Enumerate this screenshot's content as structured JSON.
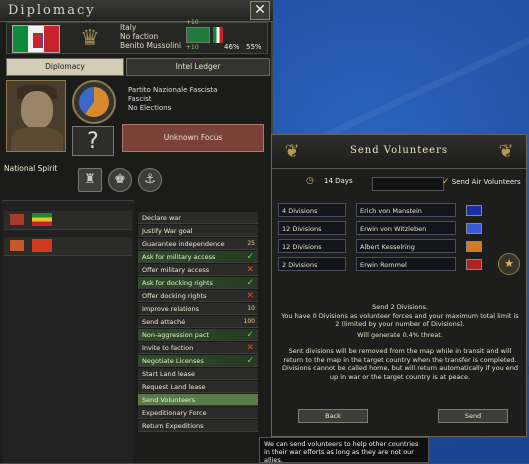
{
  "diplomacy": {
    "title": "Diplomacy",
    "close_label": "✕",
    "country": {
      "name": "Italy",
      "faction": "No faction",
      "leader": "Benito Mussolini",
      "stat_a": "46%",
      "stat_b": "55%",
      "small_a": "+10",
      "small_b": "+10"
    },
    "tabs": [
      {
        "label": "Diplomacy"
      },
      {
        "label": "Intel Ledger"
      }
    ],
    "party": {
      "name": "Partito Nazionale Fascista",
      "ideology": "Fascist",
      "elections": "No Elections"
    },
    "focus_label": "Unknown Focus",
    "question_mark": "?",
    "national_spirit_label": "National Spirit",
    "actions": [
      {
        "label": "Declare war",
        "mark": ""
      },
      {
        "label": "Justify War goal",
        "mark": ""
      },
      {
        "label": "Guarantee independence",
        "mark": "25"
      },
      {
        "label": "Ask for military access",
        "mark": "✓"
      },
      {
        "label": "Offer military access",
        "mark": "✕"
      },
      {
        "label": "Ask for docking rights",
        "mark": "✓"
      },
      {
        "label": "Offer docking rights",
        "mark": "✕"
      },
      {
        "label": "Improve relations",
        "mark": "10"
      },
      {
        "label": "Send attaché",
        "mark": "100"
      },
      {
        "label": "Non-aggression pact",
        "mark": "✓"
      },
      {
        "label": "Invite to faction",
        "mark": "✕"
      },
      {
        "label": "Negotiate Licenses",
        "mark": "✓"
      },
      {
        "label": "Start Land lease",
        "mark": ""
      },
      {
        "label": "Request Land lease",
        "mark": ""
      },
      {
        "label": "Send Volunteers",
        "mark": ""
      },
      {
        "label": "Expeditionary Force",
        "mark": ""
      },
      {
        "label": "Return Expeditions",
        "mark": ""
      }
    ]
  },
  "send_volunteers": {
    "title": "Send Volunteers",
    "days": "14 Days",
    "air_label": "Send Air Volunteers",
    "divisions": [
      {
        "count": "4 Divisions",
        "commander": "Erich von Manstein",
        "color": "#1a2ea8"
      },
      {
        "count": "12 Divisions",
        "commander": "Erwin von Witzleben",
        "color": "#3b5ad8"
      },
      {
        "count": "12 Divisions",
        "commander": "Albert Kesselring",
        "color": "#d37b22"
      },
      {
        "count": "2 Divisions",
        "commander": "Erwin Rommel",
        "color": "#b0221f"
      }
    ],
    "message": {
      "line1": "Send 2 Divisions.",
      "line2": "You have 0 Divisions as volunteer forces and your maximum total limit is 2 (limited by your number of Divisions).",
      "line3": "Will generate 0.4% threat.",
      "line4": "Sent divisions will be removed from the map while in transit and will return to the map in the target country when the transfer is completed. Divisions cannot be called home, but will return automatically if you end up in war or the target country is at peace."
    },
    "back_label": "Back",
    "send_label": "Send"
  },
  "tooltip": "We can send volunteers to help other countries in their war efforts as long as they are not our allies."
}
